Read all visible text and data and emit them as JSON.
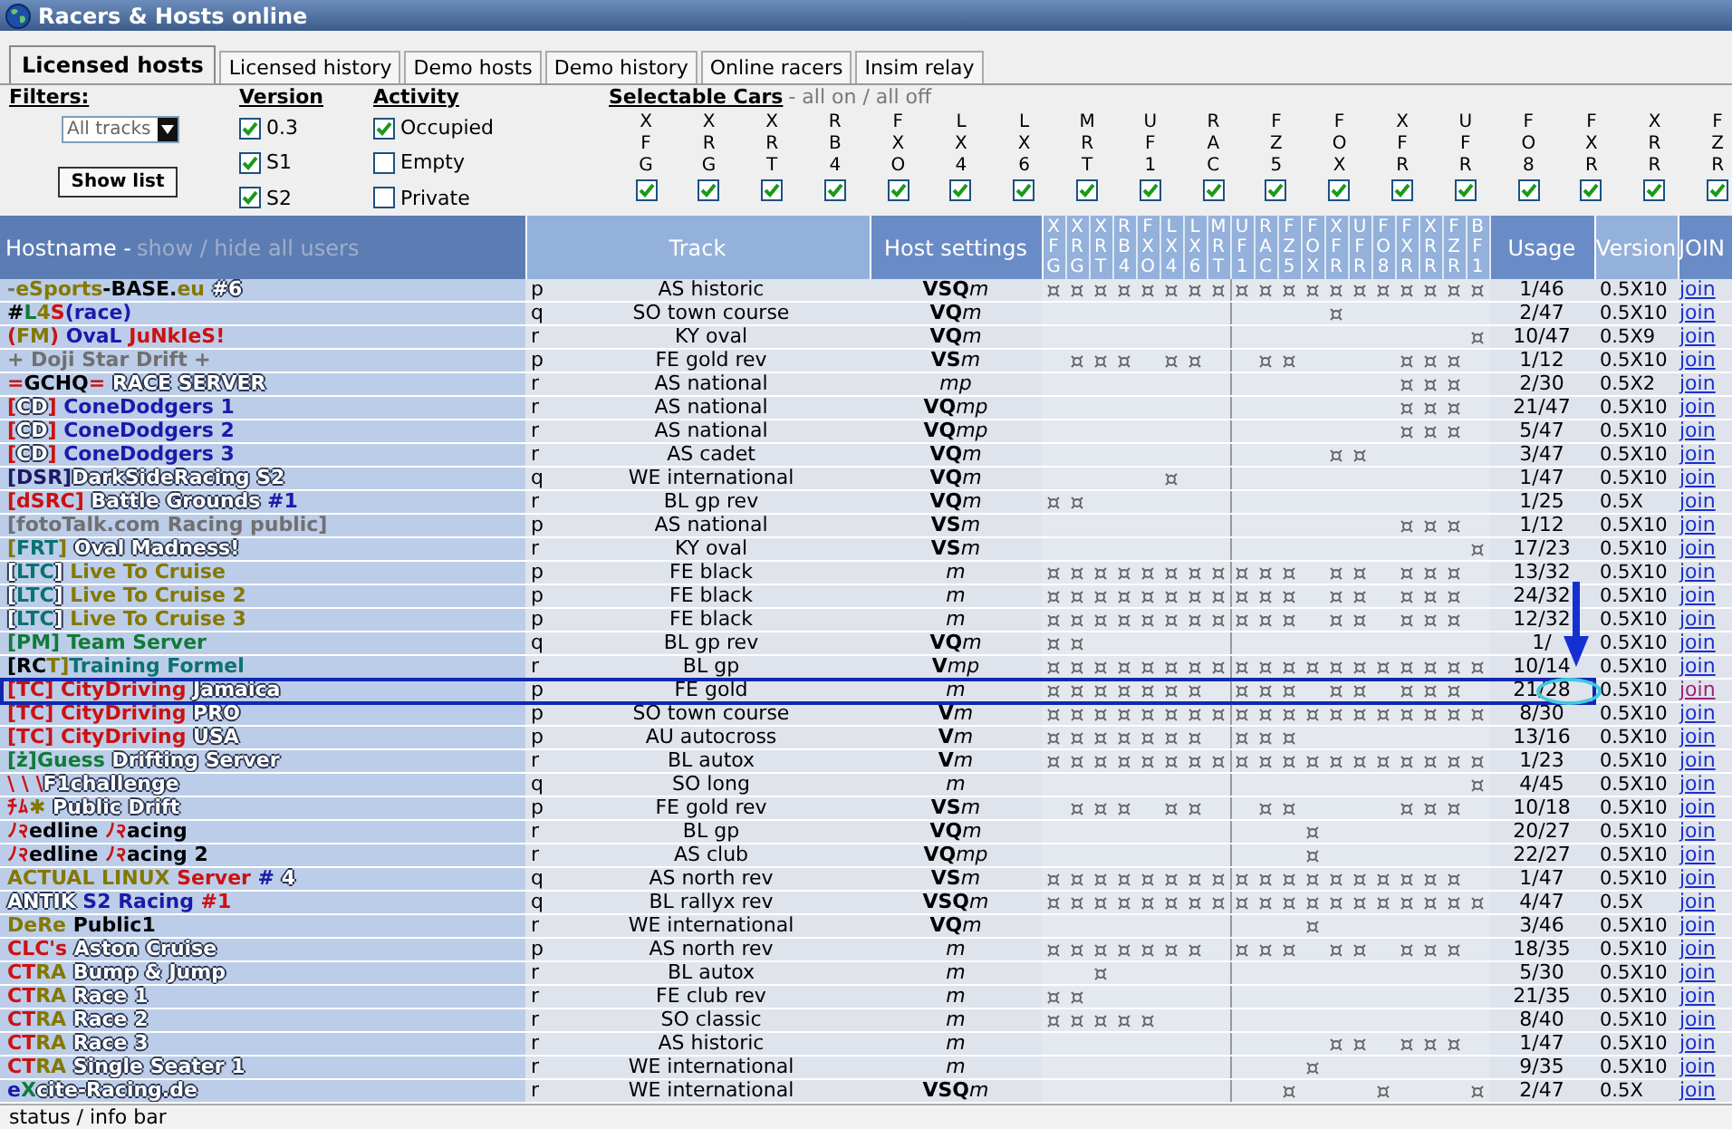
{
  "window": {
    "title": "Racers & Hosts online"
  },
  "tabs": [
    {
      "label": "Licensed hosts",
      "selected": true
    },
    {
      "label": "Licensed history",
      "selected": false
    },
    {
      "label": "Demo hosts",
      "selected": false
    },
    {
      "label": "Demo history",
      "selected": false
    },
    {
      "label": "Online racers",
      "selected": false
    },
    {
      "label": "Insim relay",
      "selected": false
    }
  ],
  "filters": {
    "label": "Filters:",
    "track_select": "All tracks",
    "button": "Show list"
  },
  "version_filter": {
    "title": "Version",
    "options": [
      {
        "label": "0.3",
        "checked": true
      },
      {
        "label": "S1",
        "checked": true
      },
      {
        "label": "S2",
        "checked": true
      }
    ]
  },
  "activity_filter": {
    "title": "Activity",
    "options": [
      {
        "label": "Occupied",
        "checked": true
      },
      {
        "label": "Empty",
        "checked": false
      },
      {
        "label": "Private",
        "checked": false
      }
    ]
  },
  "car_filter": {
    "title": "Selectable Cars",
    "toggle": "- all on / all off",
    "cars": [
      {
        "code": "XFG",
        "checked": true
      },
      {
        "code": "XRG",
        "checked": true
      },
      {
        "code": "XRT",
        "checked": true
      },
      {
        "code": "RB4",
        "checked": true
      },
      {
        "code": "FXO",
        "checked": true
      },
      {
        "code": "LX4",
        "checked": true
      },
      {
        "code": "LX6",
        "checked": true
      },
      {
        "code": "MRT",
        "checked": true
      },
      {
        "code": "UF1",
        "checked": true
      },
      {
        "code": "RAC",
        "checked": true
      },
      {
        "code": "FZ5",
        "checked": true
      },
      {
        "code": "FOX",
        "checked": true
      },
      {
        "code": "XFR",
        "checked": true
      },
      {
        "code": "UFR",
        "checked": true
      },
      {
        "code": "FO8",
        "checked": true
      },
      {
        "code": "FXR",
        "checked": true
      },
      {
        "code": "XRR",
        "checked": true
      },
      {
        "code": "FZR",
        "checked": true
      }
    ]
  },
  "table": {
    "columns": {
      "hostname": "Hostname -",
      "toggle": "show / hide all users",
      "track": "Track",
      "settings": "Host settings",
      "cars": [
        "XFG",
        "XRG",
        "XRT",
        "RB4",
        "FXO",
        "LX4",
        "LX6",
        "MRT",
        "UF1",
        "RAC",
        "FZ5",
        "FOX",
        "XFR",
        "UFR",
        "FO8",
        "FXR",
        "XRR",
        "FZR",
        "BF1"
      ],
      "usage": "Usage",
      "version": "Version",
      "join": "JOIN"
    },
    "rows": [
      {
        "name": [
          {
            "text": "-",
            "color": "#707070"
          },
          {
            "text": "eSports",
            "color": "#857800"
          },
          {
            "text": "-BASE.",
            "color": "#000000"
          },
          {
            "text": "eu",
            "color": "#857800"
          },
          {
            "text": " #6",
            "color": "#ffffff"
          }
        ],
        "type": "p",
        "track": "AS historic",
        "flags": "VSQ",
        "mode": "m",
        "cars": [
          true,
          true,
          true,
          true,
          true,
          true,
          true,
          true,
          true,
          true,
          true,
          true,
          true,
          true,
          true,
          true,
          true,
          true,
          true
        ],
        "usage": "1/46",
        "version": "0.5X10",
        "link": "join",
        "visited": false,
        "marked": false
      },
      {
        "name": [
          {
            "text": "#",
            "color": "#000000"
          },
          {
            "text": "L",
            "color": "#117a38"
          },
          {
            "text": "4",
            "color": "#857800"
          },
          {
            "text": "S",
            "color": "#cc1111"
          },
          {
            "text": "(race)",
            "color": "#1a1aaa"
          }
        ],
        "type": "q",
        "track": "SO town course",
        "flags": "VQ",
        "mode": "m",
        "cars": [
          false,
          false,
          false,
          false,
          false,
          false,
          false,
          false,
          false,
          false,
          false,
          false,
          true,
          false,
          false,
          false,
          false,
          false,
          false
        ],
        "usage": "2/47",
        "version": "0.5X10",
        "link": "join",
        "visited": false,
        "marked": false
      },
      {
        "name": [
          {
            "text": "(",
            "color": "#cc1111"
          },
          {
            "text": "FM",
            "color": "#857800"
          },
          {
            "text": ")",
            "color": "#cc1111"
          },
          {
            "text": " OvaL",
            "color": "#1a1aaa"
          },
          {
            "text": " JuNkIeS!",
            "color": "#cc1111"
          }
        ],
        "type": "r",
        "track": "KY oval",
        "flags": "VQ",
        "mode": "m",
        "cars": [
          false,
          false,
          false,
          false,
          false,
          false,
          false,
          false,
          false,
          false,
          false,
          false,
          false,
          false,
          false,
          false,
          false,
          false,
          true
        ],
        "usage": "10/47",
        "version": "0.5X9",
        "link": "join",
        "visited": false,
        "marked": false
      },
      {
        "name": [
          {
            "text": "+ Doji Star Drift +",
            "color": "#707070"
          }
        ],
        "type": "p",
        "track": "FE gold rev",
        "flags": "VS",
        "mode": "m",
        "cars": [
          false,
          true,
          true,
          true,
          false,
          true,
          true,
          false,
          false,
          true,
          true,
          false,
          false,
          false,
          false,
          true,
          true,
          true,
          false
        ],
        "usage": "1/12",
        "version": "0.5X10",
        "link": "join",
        "visited": false,
        "marked": false
      },
      {
        "name": [
          {
            "text": "=",
            "color": "#cc1111"
          },
          {
            "text": "GCHQ",
            "color": "#000000"
          },
          {
            "text": "=",
            "color": "#cc1111"
          },
          {
            "text": " RACE SERVER",
            "color": "#ffffff"
          }
        ],
        "type": "r",
        "track": "AS national",
        "mode": "mp",
        "cars": [
          false,
          false,
          false,
          false,
          false,
          false,
          false,
          false,
          false,
          false,
          false,
          false,
          false,
          false,
          false,
          true,
          true,
          true,
          false
        ],
        "usage": "2/30",
        "version": "0.5X2",
        "link": "join",
        "visited": false,
        "marked": false
      },
      {
        "name": [
          {
            "text": "[",
            "color": "#cc1111"
          },
          {
            "text": "CD",
            "color": "#ffffff"
          },
          {
            "text": "]",
            "color": "#cc1111"
          },
          {
            "text": " ConeDodgers 1",
            "color": "#1a1aaa"
          }
        ],
        "type": "r",
        "track": "AS national",
        "flags": "VQ",
        "mode": "mp",
        "cars": [
          false,
          false,
          false,
          false,
          false,
          false,
          false,
          false,
          false,
          false,
          false,
          false,
          false,
          false,
          false,
          true,
          true,
          true,
          false
        ],
        "usage": "21/47",
        "version": "0.5X10",
        "link": "join",
        "visited": false,
        "marked": false
      },
      {
        "name": [
          {
            "text": "[",
            "color": "#cc1111"
          },
          {
            "text": "CD",
            "color": "#ffffff"
          },
          {
            "text": "]",
            "color": "#cc1111"
          },
          {
            "text": " ConeDodgers 2",
            "color": "#1a1aaa"
          }
        ],
        "type": "r",
        "track": "AS national",
        "flags": "VQ",
        "mode": "mp",
        "cars": [
          false,
          false,
          false,
          false,
          false,
          false,
          false,
          false,
          false,
          false,
          false,
          false,
          false,
          false,
          false,
          true,
          true,
          true,
          false
        ],
        "usage": "5/47",
        "version": "0.5X10",
        "link": "join",
        "visited": false,
        "marked": false
      },
      {
        "name": [
          {
            "text": "[",
            "color": "#cc1111"
          },
          {
            "text": "CD",
            "color": "#ffffff"
          },
          {
            "text": "]",
            "color": "#cc1111"
          },
          {
            "text": " ConeDodgers 3",
            "color": "#1a1aaa"
          }
        ],
        "type": "r",
        "track": "AS cadet",
        "flags": "VQ",
        "mode": "m",
        "cars": [
          false,
          false,
          false,
          false,
          false,
          false,
          false,
          false,
          false,
          false,
          false,
          false,
          true,
          true,
          false,
          false,
          false,
          false,
          false
        ],
        "usage": "3/47",
        "version": "0.5X10",
        "link": "join",
        "visited": false,
        "marked": false
      },
      {
        "name": [
          {
            "text": "[DSR]",
            "color": "#1a1a66"
          },
          {
            "text": "DarkSideRacing S2",
            "color": "#ffffff"
          }
        ],
        "type": "q",
        "track": "WE international",
        "flags": "VQ",
        "mode": "m",
        "cars": [
          false,
          false,
          false,
          false,
          false,
          true,
          false,
          false,
          false,
          false,
          false,
          false,
          false,
          false,
          false,
          false,
          false,
          false,
          false
        ],
        "usage": "1/47",
        "version": "0.5X10",
        "link": "join",
        "visited": false,
        "marked": false
      },
      {
        "name": [
          {
            "text": "[dSRC]",
            "color": "#cc1111"
          },
          {
            "text": " Battle Grounds ",
            "color": "#ffffff"
          },
          {
            "text": "#1",
            "color": "#1a1aaa"
          }
        ],
        "type": "r",
        "track": "BL gp rev",
        "flags": "VQ",
        "mode": "m",
        "cars": [
          true,
          true,
          false,
          false,
          false,
          false,
          false,
          false,
          false,
          false,
          false,
          false,
          false,
          false,
          false,
          false,
          false,
          false,
          false
        ],
        "usage": "1/25",
        "version": "0.5X",
        "link": "join",
        "visited": false,
        "marked": false
      },
      {
        "name": [
          {
            "text": "[fotoTalk.com Racing public]",
            "color": "#707070"
          }
        ],
        "type": "p",
        "track": "AS national",
        "flags": "VS",
        "mode": "m",
        "cars": [
          false,
          false,
          false,
          false,
          false,
          false,
          false,
          false,
          false,
          false,
          false,
          false,
          false,
          false,
          false,
          true,
          true,
          true,
          false
        ],
        "usage": "1/12",
        "version": "0.5X10",
        "link": "join",
        "visited": false,
        "marked": false
      },
      {
        "name": [
          {
            "text": "[",
            "color": "#857800"
          },
          {
            "text": "FRT",
            "color": "#0b7272"
          },
          {
            "text": "]",
            "color": "#857800"
          },
          {
            "text": " Oval Madness!",
            "color": "#ffffff"
          }
        ],
        "type": "r",
        "track": "KY oval",
        "flags": "VS",
        "mode": "m",
        "cars": [
          false,
          false,
          false,
          false,
          false,
          false,
          false,
          false,
          false,
          false,
          false,
          false,
          false,
          false,
          false,
          false,
          false,
          false,
          true
        ],
        "usage": "17/23",
        "version": "0.5X10",
        "link": "join",
        "visited": false,
        "marked": false
      },
      {
        "name": [
          {
            "text": "[",
            "color": "#ffffff"
          },
          {
            "text": "LTC",
            "color": "#0b7272"
          },
          {
            "text": "]",
            "color": "#ffffff"
          },
          {
            "text": " Live To Cruise",
            "color": "#857800"
          }
        ],
        "type": "p",
        "track": "FE black",
        "mode": "m",
        "cars": [
          true,
          true,
          true,
          true,
          true,
          true,
          true,
          true,
          true,
          true,
          true,
          false,
          true,
          true,
          false,
          true,
          true,
          true,
          false
        ],
        "usage": "13/32",
        "version": "0.5X10",
        "link": "join",
        "visited": false,
        "marked": false
      },
      {
        "name": [
          {
            "text": "[",
            "color": "#ffffff"
          },
          {
            "text": "LTC",
            "color": "#0b7272"
          },
          {
            "text": "]",
            "color": "#ffffff"
          },
          {
            "text": " Live To Cruise 2",
            "color": "#857800"
          }
        ],
        "type": "p",
        "track": "FE black",
        "mode": "m",
        "cars": [
          true,
          true,
          true,
          true,
          true,
          true,
          true,
          true,
          true,
          true,
          true,
          false,
          true,
          true,
          false,
          true,
          true,
          true,
          false
        ],
        "usage": "24/32",
        "version": "0.5X10",
        "link": "join",
        "visited": false,
        "marked": false
      },
      {
        "name": [
          {
            "text": "[",
            "color": "#ffffff"
          },
          {
            "text": "LTC",
            "color": "#0b7272"
          },
          {
            "text": "]",
            "color": "#ffffff"
          },
          {
            "text": " Live To Cruise 3",
            "color": "#857800"
          }
        ],
        "type": "p",
        "track": "FE black",
        "mode": "m",
        "cars": [
          true,
          true,
          true,
          true,
          true,
          true,
          true,
          true,
          true,
          true,
          true,
          false,
          true,
          true,
          false,
          true,
          true,
          true,
          false
        ],
        "usage": "12/32",
        "version": "0.5X10",
        "link": "join",
        "visited": false,
        "marked": false
      },
      {
        "name": [
          {
            "text": "[PM] Team Server",
            "color": "#117a38"
          }
        ],
        "type": "q",
        "track": "BL gp rev",
        "flags": "VQ",
        "mode": "m",
        "cars": [
          true,
          true,
          false,
          false,
          false,
          false,
          false,
          false,
          false,
          false,
          false,
          false,
          false,
          false,
          false,
          false,
          false,
          false,
          false
        ],
        "usage": "1/",
        "version": "0.5X10",
        "link": "join",
        "visited": false,
        "marked": false
      },
      {
        "name": [
          {
            "text": "[RC",
            "color": "#000000"
          },
          {
            "text": "T]",
            "color": "#857800"
          },
          {
            "text": "Training Formel",
            "color": "#0b7272"
          }
        ],
        "type": "r",
        "track": "BL gp",
        "flags": "V",
        "mode": "mp",
        "cars": [
          true,
          true,
          true,
          true,
          true,
          true,
          true,
          true,
          true,
          true,
          true,
          true,
          true,
          true,
          true,
          true,
          true,
          true,
          true
        ],
        "usage": "10/14",
        "version": "0.5X10",
        "link": "join",
        "visited": false,
        "marked": false
      },
      {
        "name": [
          {
            "text": "[TC] CityDriving",
            "color": "#cc1111"
          },
          {
            "text": " Jamaica",
            "color": "#ffffff"
          }
        ],
        "type": "p",
        "track": "FE gold",
        "mode": "m",
        "cars": [
          true,
          true,
          true,
          true,
          true,
          true,
          true,
          false,
          true,
          true,
          true,
          false,
          true,
          true,
          false,
          true,
          true,
          true,
          false
        ],
        "usage": "21/28",
        "version": "0.5X10",
        "link": "join",
        "visited": true,
        "marked": true
      },
      {
        "name": [
          {
            "text": "[TC] CityDriving",
            "color": "#cc1111"
          },
          {
            "text": " PRO",
            "color": "#ffffff"
          }
        ],
        "type": "p",
        "track": "SO town course",
        "flags": "V",
        "mode": "m",
        "cars": [
          true,
          true,
          true,
          true,
          true,
          true,
          true,
          true,
          true,
          true,
          true,
          true,
          true,
          true,
          true,
          true,
          true,
          true,
          true
        ],
        "usage": "8/30",
        "version": "0.5X10",
        "link": "join",
        "visited": false,
        "marked": false
      },
      {
        "name": [
          {
            "text": "[TC] CityDriving",
            "color": "#cc1111"
          },
          {
            "text": " USA",
            "color": "#ffffff"
          }
        ],
        "type": "p",
        "track": "AU autocross",
        "flags": "V",
        "mode": "m",
        "cars": [
          true,
          true,
          true,
          true,
          true,
          true,
          true,
          false,
          true,
          true,
          true,
          false,
          false,
          false,
          false,
          false,
          false,
          false,
          false
        ],
        "usage": "13/16",
        "version": "0.5X10",
        "link": "join",
        "visited": false,
        "marked": false
      },
      {
        "name": [
          {
            "text": "[ż]Guess",
            "color": "#117a38"
          },
          {
            "text": " Drifting Server",
            "color": "#ffffff"
          }
        ],
        "type": "r",
        "track": "BL autox",
        "flags": "V",
        "mode": "m",
        "cars": [
          true,
          true,
          true,
          true,
          true,
          true,
          true,
          true,
          true,
          true,
          true,
          true,
          true,
          true,
          true,
          true,
          true,
          true,
          true
        ],
        "usage": "1/23",
        "version": "0.5X10",
        "link": "join",
        "visited": false,
        "marked": false
      },
      {
        "name": [
          {
            "text": "\\ \\ \\",
            "color": "#cc1111"
          },
          {
            "text": "F1challenge",
            "color": "#ffffff"
          }
        ],
        "type": "q",
        "track": "SO long",
        "mode": "m",
        "cars": [
          false,
          false,
          false,
          false,
          false,
          false,
          false,
          false,
          false,
          false,
          false,
          false,
          false,
          false,
          false,
          false,
          false,
          false,
          true
        ],
        "usage": "4/45",
        "version": "0.5X10",
        "link": "join",
        "visited": false,
        "marked": false
      },
      {
        "name": [
          {
            "text": "ﾁﾑ",
            "color": "#cc1111"
          },
          {
            "text": "✱",
            "color": "#857800"
          },
          {
            "text": " Public Drift",
            "color": "#ffffff"
          }
        ],
        "type": "p",
        "track": "FE gold rev",
        "flags": "VS",
        "mode": "m",
        "cars": [
          false,
          true,
          true,
          true,
          false,
          true,
          true,
          false,
          false,
          true,
          true,
          false,
          false,
          false,
          false,
          true,
          true,
          true,
          false
        ],
        "usage": "10/18",
        "version": "0.5X10",
        "link": "join",
        "visited": false,
        "marked": false
      },
      {
        "name": [
          {
            "text": "ﾉ२",
            "color": "#cc1111"
          },
          {
            "text": "edline ",
            "color": "#000000"
          },
          {
            "text": "ﾉ२",
            "color": "#cc1111"
          },
          {
            "text": "acing",
            "color": "#000000"
          }
        ],
        "type": "r",
        "track": "BL gp",
        "flags": "VQ",
        "mode": "m",
        "cars": [
          false,
          false,
          false,
          false,
          false,
          false,
          false,
          false,
          false,
          false,
          false,
          true,
          false,
          false,
          false,
          false,
          false,
          false,
          false
        ],
        "usage": "20/27",
        "version": "0.5X10",
        "link": "join",
        "visited": false,
        "marked": false
      },
      {
        "name": [
          {
            "text": "ﾉ२",
            "color": "#cc1111"
          },
          {
            "text": "edline ",
            "color": "#000000"
          },
          {
            "text": "ﾉ२",
            "color": "#cc1111"
          },
          {
            "text": "acing 2",
            "color": "#000000"
          }
        ],
        "type": "r",
        "track": "AS club",
        "flags": "VQ",
        "mode": "mp",
        "cars": [
          false,
          false,
          false,
          false,
          false,
          false,
          false,
          false,
          false,
          false,
          false,
          true,
          false,
          false,
          false,
          false,
          false,
          false,
          false
        ],
        "usage": "22/27",
        "version": "0.5X10",
        "link": "join",
        "visited": false,
        "marked": false
      },
      {
        "name": [
          {
            "text": "ACTUAL LINUX",
            "color": "#857800"
          },
          {
            "text": " Server",
            "color": "#cc1111"
          },
          {
            "text": " #",
            "color": "#1a1aaa"
          },
          {
            "text": " 4",
            "color": "#ffffff"
          }
        ],
        "type": "q",
        "track": "AS north rev",
        "flags": "VS",
        "mode": "m",
        "cars": [
          true,
          true,
          true,
          true,
          true,
          true,
          true,
          true,
          true,
          true,
          true,
          true,
          true,
          true,
          true,
          true,
          true,
          true,
          false
        ],
        "usage": "1/47",
        "version": "0.5X10",
        "link": "join",
        "visited": false,
        "marked": false
      },
      {
        "name": [
          {
            "text": "ANTIK",
            "color": "#ffffff"
          },
          {
            "text": " S2 Racing",
            "color": "#1a1aaa"
          },
          {
            "text": " #1",
            "color": "#cc1111"
          }
        ],
        "type": "q",
        "track": "BL rallyx rev",
        "flags": "VSQ",
        "mode": "m",
        "cars": [
          true,
          true,
          true,
          true,
          true,
          true,
          true,
          true,
          true,
          true,
          true,
          true,
          true,
          true,
          true,
          true,
          true,
          true,
          true
        ],
        "usage": "4/47",
        "version": "0.5X",
        "link": "join",
        "visited": false,
        "marked": false
      },
      {
        "name": [
          {
            "text": "DeRe",
            "color": "#857800"
          },
          {
            "text": " Public1",
            "color": "#000000"
          }
        ],
        "type": "r",
        "track": "WE international",
        "flags": "VQ",
        "mode": "m",
        "cars": [
          false,
          false,
          false,
          false,
          false,
          false,
          false,
          false,
          false,
          false,
          false,
          true,
          false,
          false,
          false,
          false,
          false,
          false,
          false
        ],
        "usage": "3/46",
        "version": "0.5X10",
        "link": "join",
        "visited": false,
        "marked": false
      },
      {
        "name": [
          {
            "text": "CLC's",
            "color": "#cc1111"
          },
          {
            "text": " Aston Cruise",
            "color": "#ffffff"
          }
        ],
        "type": "p",
        "track": "AS north rev",
        "mode": "m",
        "cars": [
          true,
          true,
          true,
          true,
          true,
          true,
          true,
          false,
          true,
          true,
          true,
          false,
          true,
          true,
          false,
          true,
          true,
          true,
          false
        ],
        "usage": "18/35",
        "version": "0.5X10",
        "link": "join",
        "visited": false,
        "marked": false
      },
      {
        "name": [
          {
            "text": "CT",
            "color": "#cc1111"
          },
          {
            "text": "RA",
            "color": "#857800"
          },
          {
            "text": " Bump & Jump",
            "color": "#ffffff"
          }
        ],
        "type": "r",
        "track": "BL autox",
        "mode": "m",
        "cars": [
          false,
          false,
          true,
          false,
          false,
          false,
          false,
          false,
          false,
          false,
          false,
          false,
          false,
          false,
          false,
          false,
          false,
          false,
          false
        ],
        "usage": "5/30",
        "version": "0.5X10",
        "link": "join",
        "visited": false,
        "marked": false
      },
      {
        "name": [
          {
            "text": "CT",
            "color": "#cc1111"
          },
          {
            "text": "RA",
            "color": "#857800"
          },
          {
            "text": " Race 1",
            "color": "#ffffff"
          }
        ],
        "type": "r",
        "track": "FE club rev",
        "mode": "m",
        "cars": [
          true,
          true,
          false,
          false,
          false,
          false,
          false,
          false,
          false,
          false,
          false,
          false,
          false,
          false,
          false,
          false,
          false,
          false,
          false
        ],
        "usage": "21/35",
        "version": "0.5X10",
        "link": "join",
        "visited": false,
        "marked": false
      },
      {
        "name": [
          {
            "text": "CT",
            "color": "#cc1111"
          },
          {
            "text": "RA",
            "color": "#857800"
          },
          {
            "text": " Race 2",
            "color": "#ffffff"
          }
        ],
        "type": "r",
        "track": "SO classic",
        "mode": "m",
        "cars": [
          true,
          true,
          true,
          true,
          true,
          false,
          false,
          false,
          false,
          false,
          false,
          false,
          false,
          false,
          false,
          false,
          false,
          false,
          false
        ],
        "usage": "8/40",
        "version": "0.5X10",
        "link": "join",
        "visited": false,
        "marked": false
      },
      {
        "name": [
          {
            "text": "CT",
            "color": "#cc1111"
          },
          {
            "text": "RA",
            "color": "#857800"
          },
          {
            "text": " Race 3",
            "color": "#ffffff"
          }
        ],
        "type": "r",
        "track": "AS historic",
        "mode": "m",
        "cars": [
          false,
          false,
          false,
          false,
          false,
          false,
          false,
          false,
          false,
          false,
          false,
          false,
          true,
          true,
          false,
          true,
          true,
          true,
          false
        ],
        "usage": "1/47",
        "version": "0.5X10",
        "link": "join",
        "visited": false,
        "marked": false
      },
      {
        "name": [
          {
            "text": "CT",
            "color": "#cc1111"
          },
          {
            "text": "RA",
            "color": "#857800"
          },
          {
            "text": " Single Seater 1",
            "color": "#ffffff"
          }
        ],
        "type": "r",
        "track": "WE international",
        "mode": "m",
        "cars": [
          false,
          false,
          false,
          false,
          false,
          false,
          false,
          false,
          false,
          false,
          false,
          true,
          false,
          false,
          false,
          false,
          false,
          false,
          false
        ],
        "usage": "9/35",
        "version": "0.5X10",
        "link": "join",
        "visited": false,
        "marked": false
      },
      {
        "name": [
          {
            "text": "e",
            "color": "#1a1aaa"
          },
          {
            "text": "X",
            "color": "#117a38"
          },
          {
            "text": "cite-Racing.de",
            "color": "#ffffff"
          }
        ],
        "type": "r",
        "track": "WE international",
        "flags": "VSQ",
        "mode": "m",
        "cars": [
          false,
          false,
          false,
          false,
          false,
          false,
          false,
          false,
          false,
          false,
          true,
          false,
          false,
          false,
          true,
          false,
          false,
          false,
          true
        ],
        "usage": "2/47",
        "version": "0.5X",
        "link": "join",
        "visited": false,
        "marked": false
      }
    ]
  },
  "status_bar": "status / info bar"
}
